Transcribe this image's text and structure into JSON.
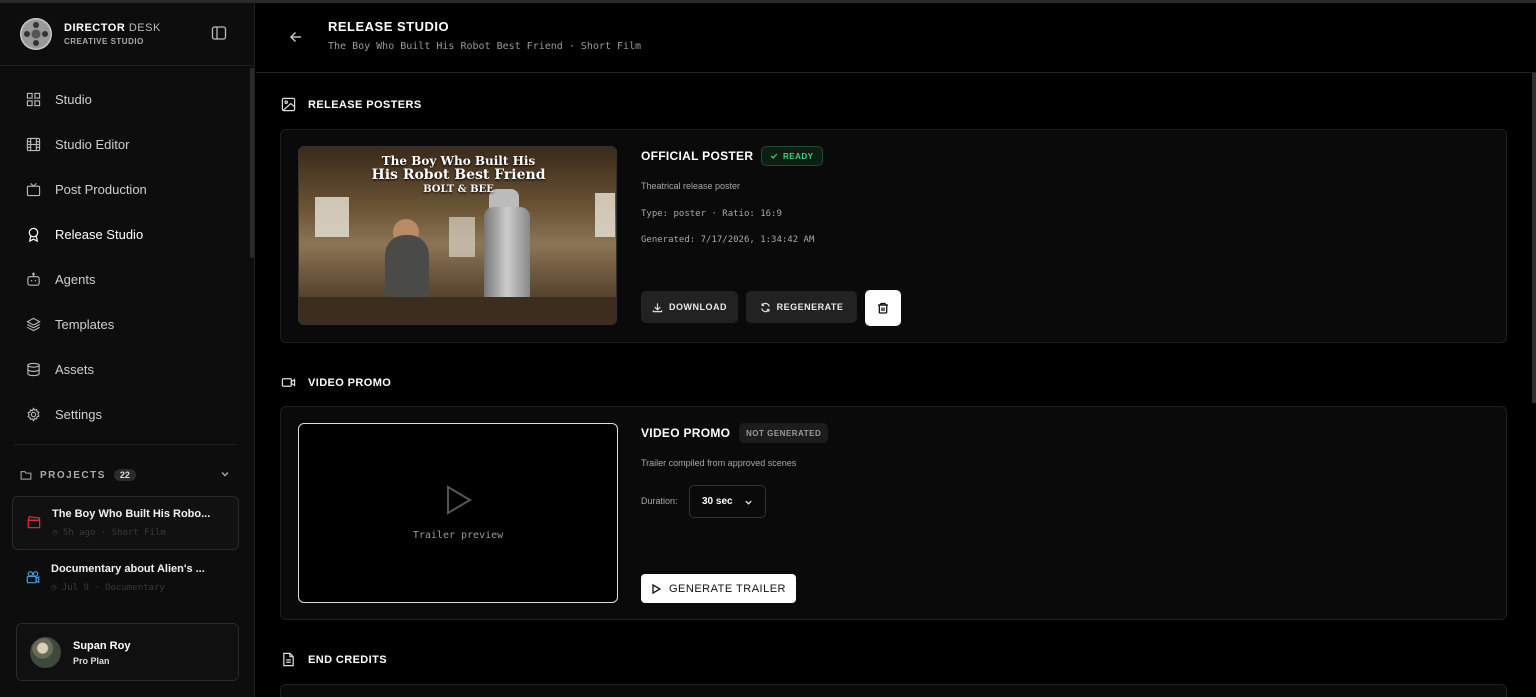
{
  "brand": {
    "title_bold": "DIRECT",
    "title_o": "O",
    "title_r": "R",
    "title_light": "DESK",
    "subtitle": "CREATIVE STUDIO"
  },
  "nav": [
    {
      "label": "Studio",
      "icon": "grid-icon"
    },
    {
      "label": "Studio Editor",
      "icon": "film-icon"
    },
    {
      "label": "Post Production",
      "icon": "tv-icon"
    },
    {
      "label": "Release Studio",
      "icon": "award-icon",
      "active": true
    },
    {
      "label": "Agents",
      "icon": "bot-icon"
    },
    {
      "label": "Templates",
      "icon": "layers-icon"
    },
    {
      "label": "Assets",
      "icon": "database-icon"
    },
    {
      "label": "Settings",
      "icon": "gear-icon"
    }
  ],
  "projects": {
    "label": "PROJECTS",
    "count": "22",
    "items": [
      {
        "title": "The Boy Who Built His Robo...",
        "meta": "◷ 5h ago · Short Film",
        "icon": "clapperboard-icon",
        "color": "#e03030"
      },
      {
        "title": "Documentary about Alien's ...",
        "meta": "◷ Jul 9 · Documentary",
        "icon": "camera-icon",
        "color": "#3aa0e0"
      }
    ]
  },
  "user": {
    "name": "Supan Roy",
    "plan": "Pro Plan"
  },
  "header": {
    "title": "RELEASE STUDIO",
    "subtitle": "The Boy Who Built His Robot Best Friend · Short Film"
  },
  "posters": {
    "section_label": "RELEASE POSTERS",
    "poster_text": {
      "line1": "The Boy Who Built His",
      "line2": "His Robot Best Friend",
      "line3": "BOLT & BEE"
    },
    "title": "OFFICIAL POSTER",
    "status": "READY",
    "description": "Theatrical release poster",
    "type_line": "Type: poster · Ratio: 16:9",
    "generated_line": "Generated: 7/17/2026, 1:34:42 AM",
    "download_label": "DOWNLOAD",
    "regenerate_label": "REGENERATE"
  },
  "video": {
    "section_label": "VIDEO PROMO",
    "title": "VIDEO PROMO",
    "status": "NOT GENERATED",
    "description": "Trailer compiled from approved scenes",
    "preview_label": "Trailer preview",
    "duration_label": "Duration:",
    "duration_value": "30 sec",
    "generate_label": "GENERATE TRAILER"
  },
  "credits": {
    "section_label": "END CREDITS"
  },
  "colors": {
    "ready": "#3fd07f",
    "accent_white": "#ffffff",
    "bg": "#000000"
  }
}
